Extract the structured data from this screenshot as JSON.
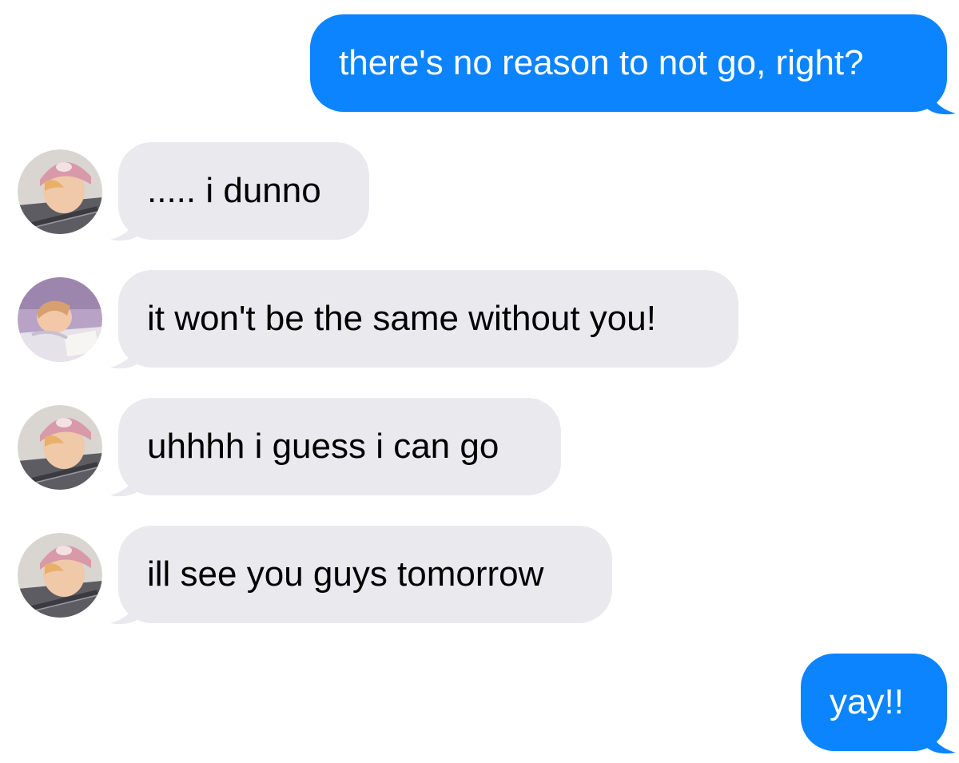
{
  "colors": {
    "outgoing_bubble": "#0b84fe",
    "incoming_bubble": "#e9e9ee",
    "outgoing_text": "#ffffff",
    "incoming_text": "#000000"
  },
  "messages": [
    {
      "direction": "outgoing",
      "text": "there's no reason to not go, right?"
    },
    {
      "direction": "incoming",
      "avatar": "avatar-pink-cap-guitar",
      "text": "..... i dunno"
    },
    {
      "direction": "incoming",
      "avatar": "avatar-purple-room",
      "text": "it won't be the same without you!"
    },
    {
      "direction": "incoming",
      "avatar": "avatar-pink-cap-guitar",
      "text": "uhhhh i guess i can go"
    },
    {
      "direction": "incoming",
      "avatar": "avatar-pink-cap-guitar",
      "text": "ill see you guys tomorrow"
    },
    {
      "direction": "outgoing",
      "text": "yay!!"
    }
  ]
}
